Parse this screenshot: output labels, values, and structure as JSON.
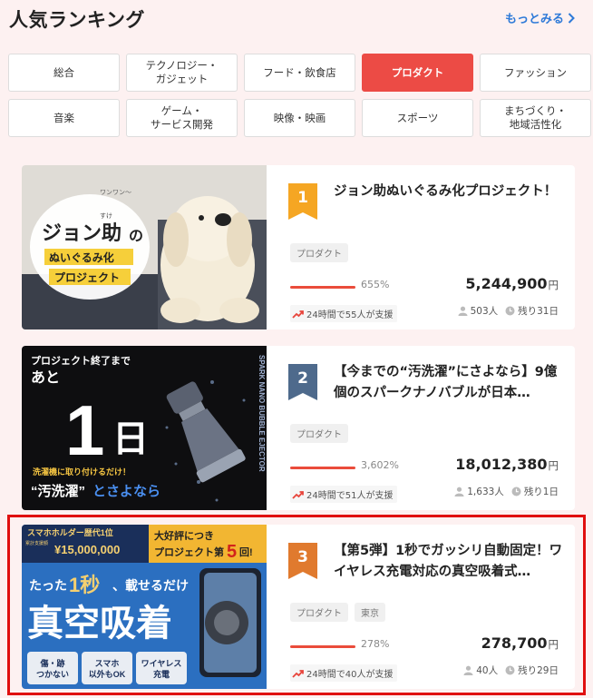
{
  "header": {
    "title": "人気ランキング",
    "more_label": "もっとみる"
  },
  "categories": [
    {
      "label": "総合",
      "active": false
    },
    {
      "label": "テクノロジー・\nガジェット",
      "active": false
    },
    {
      "label": "フード・飲食店",
      "active": false
    },
    {
      "label": "プロダクト",
      "active": true
    },
    {
      "label": "ファッション",
      "active": false
    },
    {
      "label": "音楽",
      "active": false
    },
    {
      "label": "ゲーム・\nサービス開発",
      "active": false
    },
    {
      "label": "映像・映画",
      "active": false
    },
    {
      "label": "スポーツ",
      "active": false
    },
    {
      "label": "まちづくり・\n地域活性化",
      "active": false
    }
  ],
  "projects": [
    {
      "rank": "1",
      "rank_color": "#f5a623",
      "title": "ジョン助ぬいぐるみ化プロジェクト！",
      "tags": [
        "プロダクト"
      ],
      "progress_percent": 655,
      "percent_label": "655%",
      "amount": "5,244,900",
      "currency": "円",
      "supporters_24h": "24時間で55人が支援",
      "backers": "503人",
      "remaining": "残り31日",
      "thumb": {
        "line1": "ジョン助",
        "ruby": "すけ",
        "suffix": "の",
        "line2": "ぬいぐるみ化",
        "line3": "プロジェクト",
        "badge": "ワンワン〜"
      }
    },
    {
      "rank": "2",
      "rank_color": "#4e6a8c",
      "title": "【今までの“汚洗濯”にさよなら】9億個のスパークナノバブルが日本…",
      "tags": [
        "プロダクト"
      ],
      "progress_percent": 100,
      "percent_label": "3,602%",
      "amount": "18,012,380",
      "currency": "円",
      "supporters_24h": "24時間で51人が支援",
      "backers": "1,633人",
      "remaining": "残り1日",
      "thumb": {
        "top": "プロジェクト終了まで",
        "ato": "あと",
        "big": "1",
        "day": "日",
        "small": "洗濯機に取り付けるだけ！",
        "bottom1": "“汚洗濯”",
        "bottom2": "とさよなら",
        "side": "SPARK NANO BUBBLE EJECTOR"
      }
    },
    {
      "rank": "3",
      "rank_color": "#e07a2e",
      "title": "【第5弾】1秒でガッシリ自動固定！ワイヤレス充電対応の真空吸着式…",
      "tags": [
        "プロダクト",
        "東京"
      ],
      "progress_percent": 100,
      "percent_label": "278%",
      "amount": "278,700",
      "currency": "円",
      "supporters_24h": "24時間で40人が支援",
      "backers": "40人",
      "remaining": "残り29日",
      "thumb": {
        "top1": "スマホホルダー歴代1位",
        "top2": "¥15,000,000",
        "top3": "累計支援額",
        "badge1": "大好評につき",
        "badge2": "プロジェクト第",
        "badge3": "5",
        "badge4": "回!",
        "mid1": "たった",
        "mid2": "1秒",
        "mid3": "、載せるだけ",
        "big": "真空吸着",
        "f1": "傷・跡\nつかない",
        "f2": "スマホ\n以外もOK",
        "f3": "ワイヤレス\n充電"
      }
    }
  ],
  "colors": {
    "accent": "#ec4b45",
    "link": "#2e7ad8",
    "highlight_border": "#e01010"
  }
}
